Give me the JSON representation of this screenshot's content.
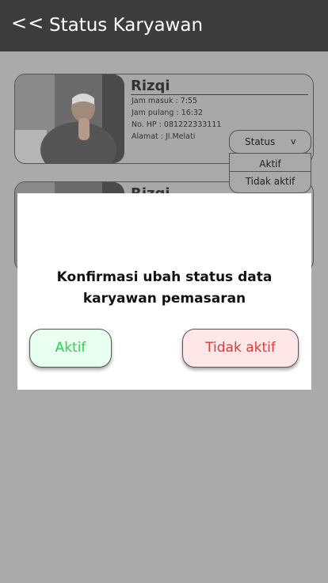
{
  "header": {
    "back_label": "<<",
    "title": "Status Karyawan"
  },
  "employees": [
    {
      "name": "Rizqi",
      "jam_masuk": "Jam masuk : 7:55",
      "jam_pulang": "Jam pulang : 16:32",
      "no_hp": "No. HP : 081222333111",
      "alamat": "Alamat : Jl.Melati"
    },
    {
      "name": "Rizqi"
    }
  ],
  "status_dropdown": {
    "label": "Status",
    "chevron": "v",
    "options": [
      "Aktif",
      "Tidak aktif"
    ]
  },
  "modal": {
    "line1": "Konfirmasi ubah status data",
    "line2": "karyawan pemasaran",
    "aktif_label": "Aktif",
    "tidak_aktif_label": "Tidak aktif"
  },
  "colors": {
    "header_bg": "#3c3c3c",
    "overlay_bg": "#aaaaaa",
    "aktif_text": "#2ecf55",
    "aktif_bg": "#e9fff0",
    "tidak_text": "#e13a3a",
    "tidak_bg": "#ffe7e7"
  }
}
